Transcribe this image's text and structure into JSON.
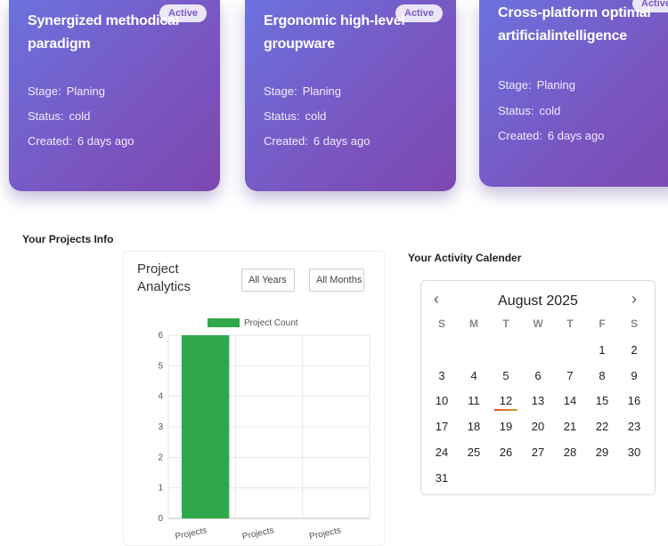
{
  "cards": [
    {
      "title": "Synergized methodical paradigm",
      "badge": "Active",
      "stage_label": "Stage:",
      "stage": "Planing",
      "status_label": "Status:",
      "status": "cold",
      "created_label": "Created:",
      "created": "6 days ago"
    },
    {
      "title": "Ergonomic high-level groupware",
      "badge": "Active",
      "stage_label": "Stage:",
      "stage": "Planing",
      "status_label": "Status:",
      "status": "cold",
      "created_label": "Created:",
      "created": "6 days ago"
    },
    {
      "title": "Cross-platform optimal artificialintelligence",
      "badge": "Active",
      "stage_label": "Stage:",
      "stage": "Planing",
      "status_label": "Status:",
      "status": "cold",
      "created_label": "Created:",
      "created": "6 days ago"
    }
  ],
  "projects_info": {
    "heading": "Your Projects Info"
  },
  "analytics": {
    "title": "Project Analytics",
    "year_select": "All Years",
    "month_select": "All Months"
  },
  "chart_data": {
    "type": "bar",
    "categories": [
      "Projects",
      "Projects",
      "Projects"
    ],
    "series": [
      {
        "name": "Project Count",
        "values": [
          6,
          0,
          0
        ],
        "color": "#2ea84a"
      }
    ],
    "ylim": [
      0,
      6
    ],
    "yticks": [
      "0",
      "1",
      "2",
      "3",
      "4",
      "5",
      "6"
    ],
    "grid": true,
    "legend": "top"
  },
  "calendar": {
    "heading": "Your Activity Calender",
    "month": "August 2025",
    "prev": "‹",
    "next": "›",
    "weekdays": [
      "S",
      "M",
      "T",
      "W",
      "T",
      "F",
      "S"
    ],
    "weeks": [
      [
        "",
        "",
        "",
        "",
        "",
        "1",
        "2"
      ],
      [
        "3",
        "4",
        "5",
        "6",
        "7",
        "8",
        "9"
      ],
      [
        "10",
        "11",
        "12",
        "13",
        "14",
        "15",
        "16"
      ],
      [
        "17",
        "18",
        "19",
        "20",
        "21",
        "22",
        "23"
      ],
      [
        "24",
        "25",
        "26",
        "27",
        "28",
        "29",
        "30"
      ],
      [
        "31",
        "",
        "",
        "",
        "",
        "",
        ""
      ]
    ],
    "today": "12"
  }
}
